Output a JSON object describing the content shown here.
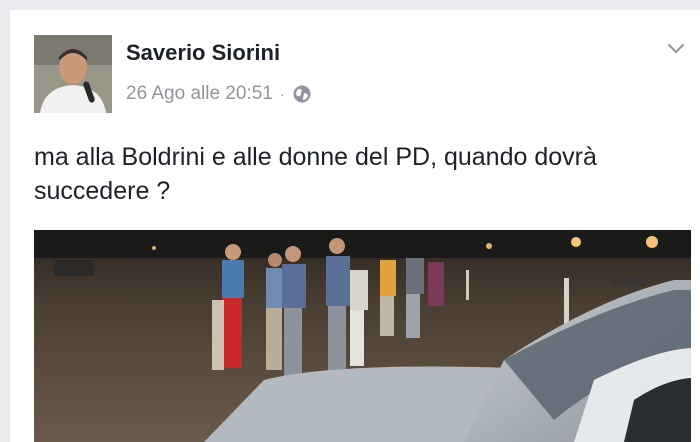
{
  "post": {
    "author_name": "Saverio Siorini",
    "timestamp": "26 Ago alle 20:51",
    "separator": "·",
    "audience_icon": "globe-icon",
    "options_icon": "chevron-down-icon",
    "text": "ma alla Boldrini e alle donne del PD, quando dovrà succedere ?"
  },
  "photo": {
    "description_icon": "photo-image"
  },
  "colors": {
    "author": "#1d2129",
    "meta": "#90949c",
    "background": "#e9ebee",
    "card": "#ffffff"
  }
}
